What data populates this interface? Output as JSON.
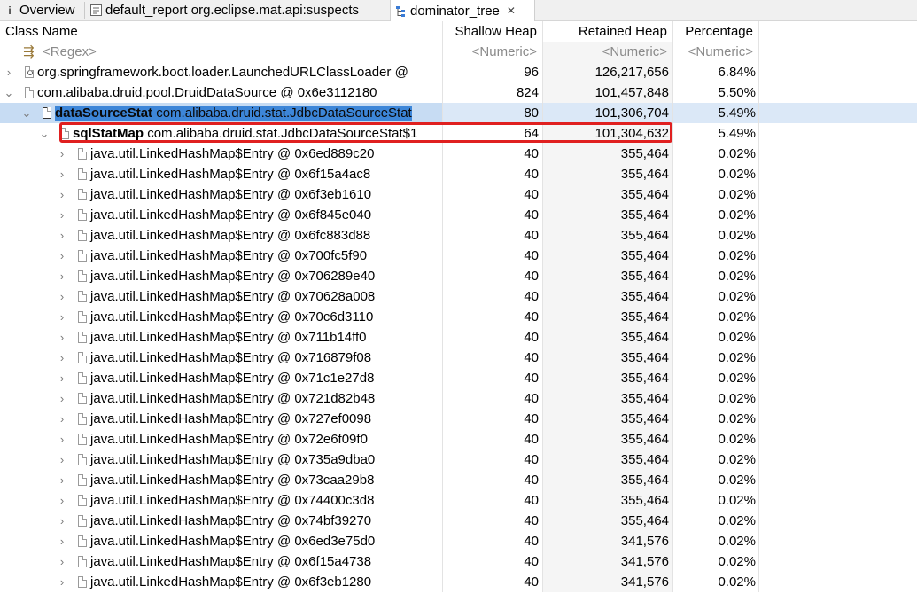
{
  "tabs": [
    {
      "icon": "info-icon",
      "label": "Overview"
    },
    {
      "icon": "report-icon",
      "label": "default_report org.eclipse.mat.api:suspects"
    },
    {
      "icon": "tree-icon",
      "label": "dominator_tree",
      "active": true
    }
  ],
  "columns": [
    "Class Name",
    "Shallow Heap",
    "Retained Heap",
    "Percentage"
  ],
  "filter_row": {
    "name": "<Regex>",
    "shallow": "<Numeric>",
    "retained": "<Numeric>",
    "percentage": "<Numeric>"
  },
  "rows": [
    {
      "depth": 0,
      "expanded": false,
      "field": "",
      "name": "org.springframework.boot.loader.LaunchedURLClassLoader @",
      "shallow": "96",
      "retained": "126,217,656",
      "percentage": "6.84%",
      "icon": "classloader"
    },
    {
      "depth": 0,
      "expanded": true,
      "field": "",
      "name": "com.alibaba.druid.pool.DruidDataSource @ 0x6e3112180",
      "shallow": "824",
      "retained": "101,457,848",
      "percentage": "5.50%",
      "icon": "object"
    },
    {
      "depth": 1,
      "expanded": true,
      "field": "dataSourceStat",
      "name": "com.alibaba.druid.stat.JdbcDataSourceStat",
      "shallow": "80",
      "retained": "101,306,704",
      "percentage": "5.49%",
      "icon": "object",
      "selected": true
    },
    {
      "depth": 2,
      "expanded": true,
      "field": "sqlStatMap",
      "name": "com.alibaba.druid.stat.JdbcDataSourceStat$1",
      "shallow": "64",
      "retained": "101,304,632",
      "percentage": "5.49%",
      "icon": "object",
      "highlighted": true
    },
    {
      "depth": 3,
      "expanded": false,
      "field": "",
      "name": "java.util.LinkedHashMap$Entry @ 0x6ed889c20",
      "shallow": "40",
      "retained": "355,464",
      "percentage": "0.02%",
      "icon": "object"
    },
    {
      "depth": 3,
      "expanded": false,
      "field": "",
      "name": "java.util.LinkedHashMap$Entry @ 0x6f15a4ac8",
      "shallow": "40",
      "retained": "355,464",
      "percentage": "0.02%",
      "icon": "object"
    },
    {
      "depth": 3,
      "expanded": false,
      "field": "",
      "name": "java.util.LinkedHashMap$Entry @ 0x6f3eb1610",
      "shallow": "40",
      "retained": "355,464",
      "percentage": "0.02%",
      "icon": "object"
    },
    {
      "depth": 3,
      "expanded": false,
      "field": "",
      "name": "java.util.LinkedHashMap$Entry @ 0x6f845e040",
      "shallow": "40",
      "retained": "355,464",
      "percentage": "0.02%",
      "icon": "object"
    },
    {
      "depth": 3,
      "expanded": false,
      "field": "",
      "name": "java.util.LinkedHashMap$Entry @ 0x6fc883d88",
      "shallow": "40",
      "retained": "355,464",
      "percentage": "0.02%",
      "icon": "object"
    },
    {
      "depth": 3,
      "expanded": false,
      "field": "",
      "name": "java.util.LinkedHashMap$Entry @ 0x700fc5f90",
      "shallow": "40",
      "retained": "355,464",
      "percentage": "0.02%",
      "icon": "object"
    },
    {
      "depth": 3,
      "expanded": false,
      "field": "",
      "name": "java.util.LinkedHashMap$Entry @ 0x706289e40",
      "shallow": "40",
      "retained": "355,464",
      "percentage": "0.02%",
      "icon": "object"
    },
    {
      "depth": 3,
      "expanded": false,
      "field": "",
      "name": "java.util.LinkedHashMap$Entry @ 0x70628a008",
      "shallow": "40",
      "retained": "355,464",
      "percentage": "0.02%",
      "icon": "object"
    },
    {
      "depth": 3,
      "expanded": false,
      "field": "",
      "name": "java.util.LinkedHashMap$Entry @ 0x70c6d3110",
      "shallow": "40",
      "retained": "355,464",
      "percentage": "0.02%",
      "icon": "object"
    },
    {
      "depth": 3,
      "expanded": false,
      "field": "",
      "name": "java.util.LinkedHashMap$Entry @ 0x711b14ff0",
      "shallow": "40",
      "retained": "355,464",
      "percentage": "0.02%",
      "icon": "object"
    },
    {
      "depth": 3,
      "expanded": false,
      "field": "",
      "name": "java.util.LinkedHashMap$Entry @ 0x716879f08",
      "shallow": "40",
      "retained": "355,464",
      "percentage": "0.02%",
      "icon": "object"
    },
    {
      "depth": 3,
      "expanded": false,
      "field": "",
      "name": "java.util.LinkedHashMap$Entry @ 0x71c1e27d8",
      "shallow": "40",
      "retained": "355,464",
      "percentage": "0.02%",
      "icon": "object"
    },
    {
      "depth": 3,
      "expanded": false,
      "field": "",
      "name": "java.util.LinkedHashMap$Entry @ 0x721d82b48",
      "shallow": "40",
      "retained": "355,464",
      "percentage": "0.02%",
      "icon": "object"
    },
    {
      "depth": 3,
      "expanded": false,
      "field": "",
      "name": "java.util.LinkedHashMap$Entry @ 0x727ef0098",
      "shallow": "40",
      "retained": "355,464",
      "percentage": "0.02%",
      "icon": "object"
    },
    {
      "depth": 3,
      "expanded": false,
      "field": "",
      "name": "java.util.LinkedHashMap$Entry @ 0x72e6f09f0",
      "shallow": "40",
      "retained": "355,464",
      "percentage": "0.02%",
      "icon": "object"
    },
    {
      "depth": 3,
      "expanded": false,
      "field": "",
      "name": "java.util.LinkedHashMap$Entry @ 0x735a9dba0",
      "shallow": "40",
      "retained": "355,464",
      "percentage": "0.02%",
      "icon": "object"
    },
    {
      "depth": 3,
      "expanded": false,
      "field": "",
      "name": "java.util.LinkedHashMap$Entry @ 0x73caa29b8",
      "shallow": "40",
      "retained": "355,464",
      "percentage": "0.02%",
      "icon": "object"
    },
    {
      "depth": 3,
      "expanded": false,
      "field": "",
      "name": "java.util.LinkedHashMap$Entry @ 0x74400c3d8",
      "shallow": "40",
      "retained": "355,464",
      "percentage": "0.02%",
      "icon": "object"
    },
    {
      "depth": 3,
      "expanded": false,
      "field": "",
      "name": "java.util.LinkedHashMap$Entry @ 0x74bf39270",
      "shallow": "40",
      "retained": "355,464",
      "percentage": "0.02%",
      "icon": "object"
    },
    {
      "depth": 3,
      "expanded": false,
      "field": "",
      "name": "java.util.LinkedHashMap$Entry @ 0x6ed3e75d0",
      "shallow": "40",
      "retained": "341,576",
      "percentage": "0.02%",
      "icon": "object"
    },
    {
      "depth": 3,
      "expanded": false,
      "field": "",
      "name": "java.util.LinkedHashMap$Entry @ 0x6f15a4738",
      "shallow": "40",
      "retained": "341,576",
      "percentage": "0.02%",
      "icon": "object"
    },
    {
      "depth": 3,
      "expanded": false,
      "field": "",
      "name": "java.util.LinkedHashMap$Entry @ 0x6f3eb1280",
      "shallow": "40",
      "retained": "341,576",
      "percentage": "0.02%",
      "icon": "object"
    }
  ],
  "colors": {
    "selection": "#3d86d8",
    "highlight_box": "#e02020"
  }
}
